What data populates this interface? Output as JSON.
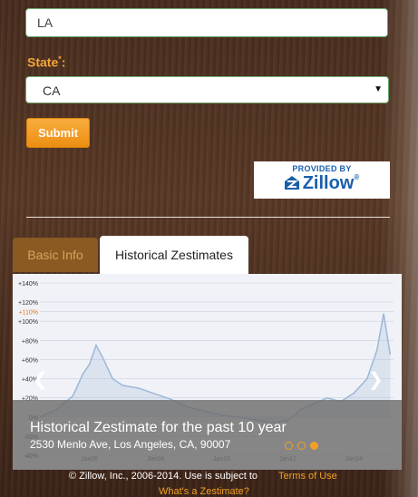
{
  "form": {
    "city_value": "LA",
    "state_label": "State",
    "required_mark": "*",
    "state_colon": ":",
    "state_value": "CA",
    "submit_label": "Submit"
  },
  "badge": {
    "provided_by": "PROVIDED BY",
    "brand": "Zillow"
  },
  "tabs": [
    {
      "label": "Basic Info",
      "active": false
    },
    {
      "label": "Historical Zestimates",
      "active": true
    }
  ],
  "overlay": {
    "title": "Historical Zestimate for the past 10 year",
    "address": "2530 Menlo Ave, Los Angeles, CA, 90007"
  },
  "footer": {
    "copyright": "© Zillow, Inc., 2006-2014. Use is subject to",
    "terms_link": "Terms of Use",
    "whats_link": "What's a Zestimate?"
  },
  "colors": {
    "accent": "#f2a023",
    "line": "#9db8d8",
    "zillow_blue": "#1a5fab"
  },
  "chart_data": {
    "type": "line",
    "x": [
      "Jan06",
      "Jan08",
      "Jan10",
      "Jan12",
      "Jan14"
    ],
    "x_positions_years": [
      2006,
      2008,
      2010,
      2012,
      2014
    ],
    "y_ticks": [
      "+140%",
      "+120%",
      "+110%",
      "+100%",
      "+80%",
      "+60%",
      "+40%",
      "+20%",
      "0%",
      "-20%",
      "-40%"
    ],
    "highlight_tick": "+110%",
    "ylim": [
      -40,
      140
    ],
    "series": [
      {
        "points": [
          [
            2004.5,
            0
          ],
          [
            2005.0,
            8
          ],
          [
            2005.5,
            22
          ],
          [
            2005.8,
            45
          ],
          [
            2006.0,
            55
          ],
          [
            2006.2,
            75
          ],
          [
            2006.4,
            62
          ],
          [
            2006.7,
            40
          ],
          [
            2007.0,
            33
          ],
          [
            2007.5,
            30
          ],
          [
            2008.0,
            24
          ],
          [
            2008.5,
            18
          ],
          [
            2009.0,
            10
          ],
          [
            2009.5,
            6
          ],
          [
            2010.0,
            2
          ],
          [
            2010.5,
            0
          ],
          [
            2011.0,
            -3
          ],
          [
            2011.5,
            -6
          ],
          [
            2012.0,
            -4
          ],
          [
            2012.4,
            8
          ],
          [
            2012.8,
            14
          ],
          [
            2013.2,
            20
          ],
          [
            2013.6,
            16
          ],
          [
            2014.0,
            25
          ],
          [
            2014.4,
            40
          ],
          [
            2014.7,
            70
          ],
          [
            2014.9,
            108
          ],
          [
            2015.1,
            65
          ]
        ]
      }
    ]
  }
}
